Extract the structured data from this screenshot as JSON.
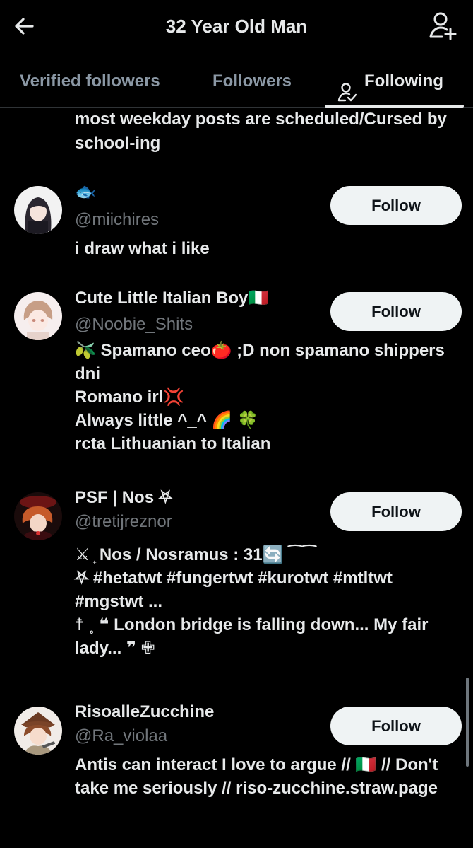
{
  "header": {
    "title": "32 Year Old Man"
  },
  "tabs": [
    {
      "label": "Verified followers",
      "active": false
    },
    {
      "label": "Followers",
      "active": false
    },
    {
      "label": "Following",
      "active": true
    }
  ],
  "top_bio": "most weekday posts are scheduled/Cursed by school-ing",
  "users": [
    {
      "name": "🐟",
      "handle": "@miichires",
      "bio": "i draw what i like",
      "follow_label": "Follow"
    },
    {
      "name": "Cute Little Italian Boy🇮🇹",
      "handle": "@Noobie_Shits",
      "bio": "🫒 Spamano ceo🍅 ;D non spamano shippers dni\nRomano irl💢\nAlways little ^_^ 🌈 🍀\nrcta Lithuanian to Italian",
      "follow_label": "Follow"
    },
    {
      "name": "PSF | Nos ⛧",
      "handle": "@tretijreznor",
      "bio": "⚔︎ ̟ Nos / Nosramus : 31🔄 ⁀⁀\n⛧ #hetatwt #fungertwt #kurotwt #mtltwt #mgstwt ...\n☨ ˳ ❝ London bridge is falling down... My fair lady... ❞ ✙",
      "follow_label": "Follow"
    },
    {
      "name": "RisoalleZucchine",
      "handle": "@Ra_violaa",
      "bio": "Antis can interact I love to argue // 🇮🇹 // Don't take me seriously // riso-zucchine.straw.page",
      "follow_label": "Follow"
    }
  ],
  "colors": {
    "background": "#000000",
    "text": "#e7e9ea",
    "secondary_text": "#71767b",
    "button_bg": "#eff3f4",
    "button_text": "#0f1419"
  }
}
